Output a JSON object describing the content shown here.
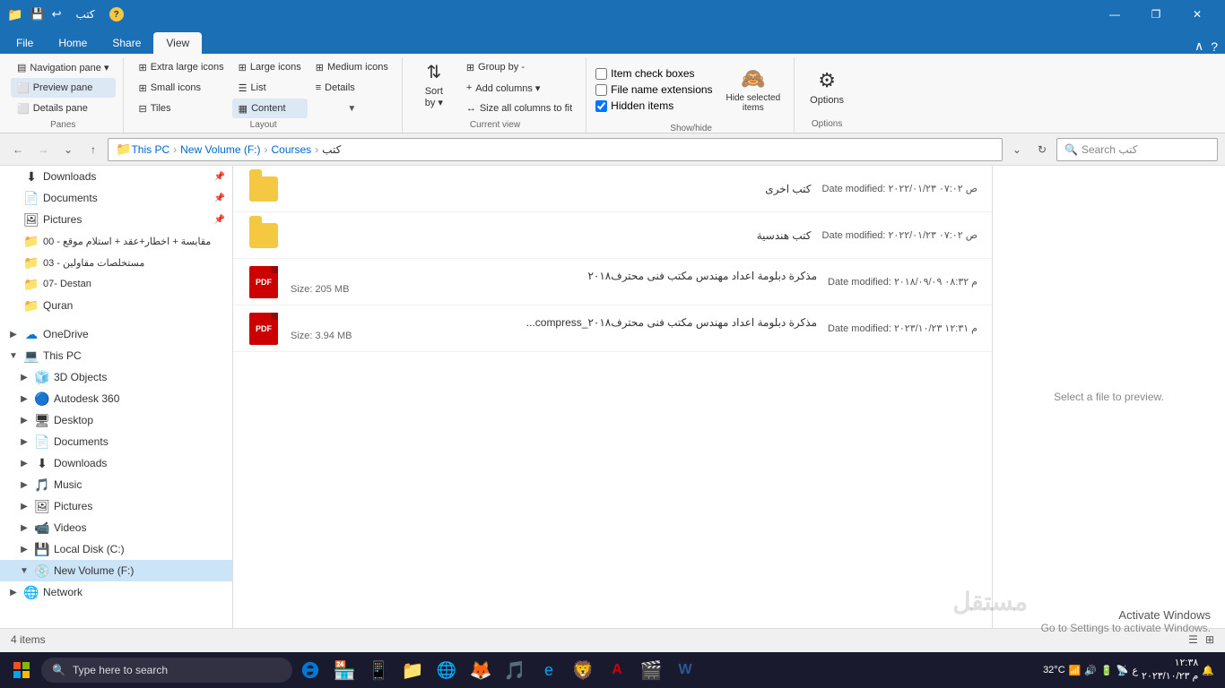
{
  "titlebar": {
    "title": "كتب",
    "icons": [
      "📁",
      "💾",
      "↩"
    ],
    "controls": [
      "—",
      "❐",
      "✕"
    ]
  },
  "ribbon": {
    "tabs": [
      "File",
      "Home",
      "Share",
      "View"
    ],
    "active_tab": "View",
    "groups": {
      "panes": {
        "label": "Panes",
        "items": [
          {
            "label": "Navigation pane",
            "icon": "▤"
          },
          {
            "label": "Preview pane",
            "icon": "⬜",
            "active": true
          },
          {
            "label": "Details pane",
            "icon": "⬜"
          }
        ]
      },
      "layout": {
        "label": "Layout",
        "items": [
          "Extra large icons",
          "Large icons",
          "Medium icons",
          "Small icons",
          "List",
          "Details",
          "Tiles",
          "Content"
        ],
        "active": "Content"
      },
      "current_view": {
        "label": "Current view",
        "sort_by": "Sort by",
        "group_by": "Group by -",
        "add_columns": "Add columns",
        "size_all_columns": "Size all columns to fit"
      },
      "show_hide": {
        "label": "Show/hide",
        "item_check_boxes": "Item check boxes",
        "file_name_extensions": "File name extensions",
        "hidden_items": "Hidden items",
        "hidden_items_checked": true,
        "hide_selected": "Hide selected items"
      },
      "options": {
        "label": "Options",
        "text": "Options"
      }
    }
  },
  "navbar": {
    "breadcrumb": [
      "This PC",
      "New Volume (F:)",
      "Courses",
      "كتب"
    ],
    "search_placeholder": "Search كتب"
  },
  "sidebar": {
    "items": [
      {
        "label": "Downloads",
        "icon": "⬇",
        "level": 0,
        "pinned": true,
        "expand": ""
      },
      {
        "label": "Documents",
        "icon": "📄",
        "level": 0,
        "pinned": true,
        "expand": ""
      },
      {
        "label": "Pictures",
        "icon": "🖼",
        "level": 0,
        "pinned": true,
        "expand": ""
      },
      {
        "label": "مقايسة + اخطار+عقد + استلام موقع - 00",
        "icon": "📁",
        "level": 0,
        "pinned": false,
        "expand": ""
      },
      {
        "label": "مستخلصات مقاولين - 03",
        "icon": "📁",
        "level": 0,
        "pinned": false,
        "expand": ""
      },
      {
        "label": "07- Destan",
        "icon": "📁",
        "level": 0,
        "pinned": false,
        "expand": ""
      },
      {
        "label": "Quran",
        "icon": "📁",
        "level": 0,
        "pinned": false,
        "expand": ""
      },
      {
        "label": "OneDrive",
        "icon": "☁",
        "level": 0,
        "pinned": false,
        "expand": "▶"
      },
      {
        "label": "This PC",
        "icon": "💻",
        "level": 0,
        "pinned": false,
        "expand": "▼"
      },
      {
        "label": "3D Objects",
        "icon": "🧊",
        "level": 1,
        "pinned": false,
        "expand": "▶"
      },
      {
        "label": "Autodesk 360",
        "icon": "🔵",
        "level": 1,
        "pinned": false,
        "expand": "▶"
      },
      {
        "label": "Desktop",
        "icon": "🖥",
        "level": 1,
        "pinned": false,
        "expand": "▶"
      },
      {
        "label": "Documents",
        "icon": "📄",
        "level": 1,
        "pinned": false,
        "expand": "▶"
      },
      {
        "label": "Downloads",
        "icon": "⬇",
        "level": 1,
        "pinned": false,
        "expand": "▶"
      },
      {
        "label": "Music",
        "icon": "🎵",
        "level": 1,
        "pinned": false,
        "expand": "▶"
      },
      {
        "label": "Pictures",
        "icon": "🖼",
        "level": 1,
        "pinned": false,
        "expand": "▶"
      },
      {
        "label": "Videos",
        "icon": "📹",
        "level": 1,
        "pinned": false,
        "expand": "▶"
      },
      {
        "label": "Local Disk (C:)",
        "icon": "💾",
        "level": 1,
        "pinned": false,
        "expand": "▶"
      },
      {
        "label": "New Volume (F:)",
        "icon": "💿",
        "level": 1,
        "pinned": false,
        "expand": "▼",
        "selected": true
      },
      {
        "label": "Network",
        "icon": "🌐",
        "level": 0,
        "pinned": false,
        "expand": "▶"
      }
    ]
  },
  "files": [
    {
      "name": "كتب اخرى",
      "type": "folder",
      "date_modified": "Date modified: ۲۰۲۲/۰۱/۲۳ ص ۰۷:۰۲",
      "size": ""
    },
    {
      "name": "كتب هندسية",
      "type": "folder",
      "date_modified": "Date modified: ۲۰۲۲/۰۱/۲۳ ص ۰۷:۰۲",
      "size": ""
    },
    {
      "name": "مذكرة دبلومة اعداد مهندس مكتب فنى محترف۲۰۱۸",
      "type": "pdf",
      "date_modified": "Date modified: ۲۰۱۸/۰۹/۰۹ م ۰۸:۳۲",
      "size": "Size: 205 MB"
    },
    {
      "name": "مذكرة دبلومة اعداد مهندس مكتب فنى محترف۲۰۱۸_compress...",
      "type": "pdf",
      "date_modified": "Date modified: ۲۰۲۳/۱۰/۲۳ م ۱۲:۳۱",
      "size": "Size: 3.94 MB"
    }
  ],
  "status_bar": {
    "count": "4 items"
  },
  "preview_pane": {
    "text": "Select a file to preview."
  },
  "activate_windows": {
    "line1": "Activate Windows",
    "line2": "Go to Settings to activate Windows."
  },
  "taskbar": {
    "search_placeholder": "Type here to search",
    "clock": "۱۲:۳۸",
    "date": "م ۲۰۲۳/۱۰/۲۳",
    "temperature": "32°C"
  }
}
